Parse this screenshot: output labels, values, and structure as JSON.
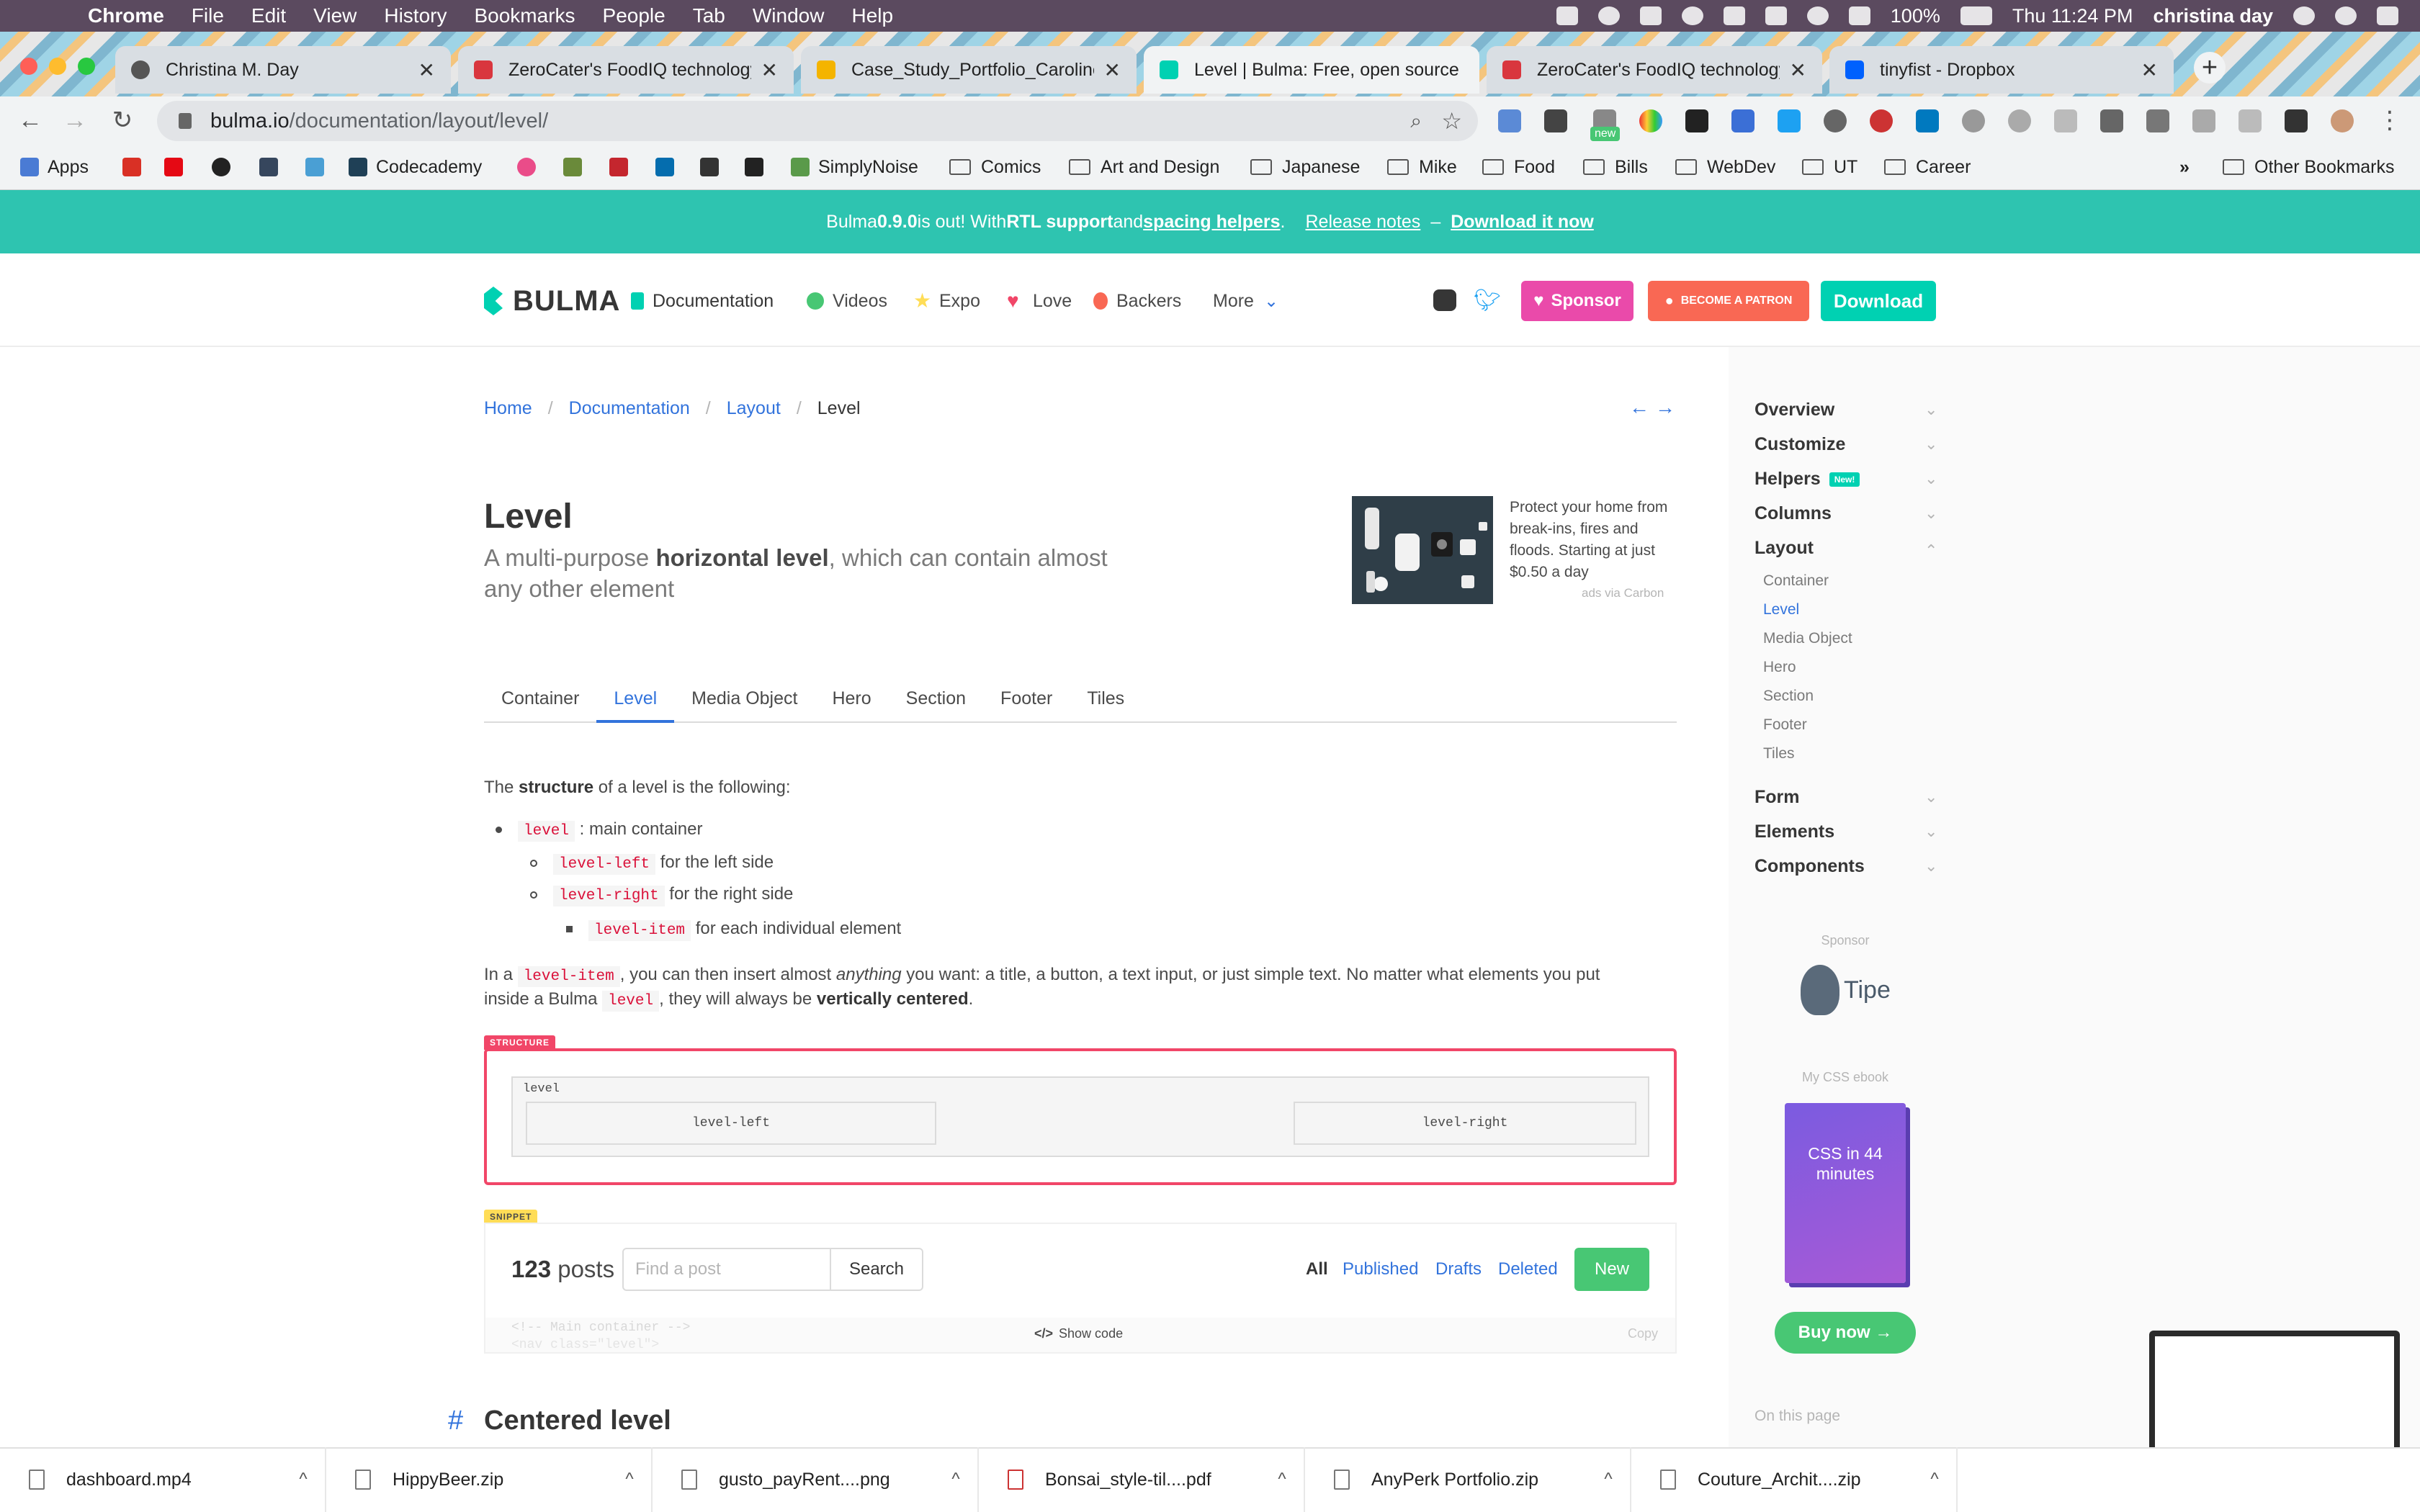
{
  "menubar": {
    "app": "Chrome",
    "items": [
      "File",
      "Edit",
      "View",
      "History",
      "Bookmarks",
      "People",
      "Tab",
      "Window",
      "Help"
    ],
    "battery": "100%",
    "clock": "Thu 11:24 PM",
    "user": "christina day"
  },
  "tabs": [
    {
      "title": "Christina M. Day"
    },
    {
      "title": "ZeroCater's FoodIQ technology"
    },
    {
      "title": "Case_Study_Portfolio_Caroline"
    },
    {
      "title": "Level | Bulma: Free, open source"
    },
    {
      "title": "ZeroCater's FoodIQ technology"
    },
    {
      "title": "tinyfist - Dropbox"
    }
  ],
  "omnibox": {
    "host": "bulma.io",
    "path": "/documentation/layout/level/"
  },
  "extension_badge": "new",
  "bookmarks": {
    "items": [
      "Apps",
      "Codecademy",
      "SimplyNoise",
      "Comics",
      "Art and Design",
      "Japanese",
      "Mike",
      "Food",
      "Bills",
      "WebDev",
      "UT",
      "Career"
    ],
    "overflow": "»",
    "other": "Other Bookmarks"
  },
  "banner": {
    "p1": "Bulma ",
    "version": "0.9.0",
    "p2": " is out! With ",
    "rtl": "RTL support",
    "p3": " and ",
    "spacing": "spacing helpers",
    "p4": ".",
    "release": "Release notes",
    "dash": "–",
    "download": "Download it now"
  },
  "navbar": {
    "logo": "BULMA",
    "items": [
      "Documentation",
      "Videos",
      "Expo",
      "Love",
      "Backers",
      "More"
    ],
    "sponsor": "Sponsor",
    "patron": "BECOME A PATRON",
    "download": "Download"
  },
  "breadcrumb": [
    "Home",
    "Documentation",
    "Layout",
    "Level"
  ],
  "hero": {
    "title": "Level",
    "sub1": "A multi-purpose ",
    "sub_bold": "horizontal level",
    "sub2": ", which can contain almost any other element"
  },
  "ad": {
    "text": "Protect your home from break-ins, fires and floods. Starting at just $0.50 a day",
    "via": "ads via Carbon"
  },
  "doc_tabs": [
    "Container",
    "Level",
    "Media Object",
    "Hero",
    "Section",
    "Footer",
    "Tiles"
  ],
  "content": {
    "intro1": "The ",
    "intro_bold": "structure",
    "intro2": " of a level is the following:",
    "li1_code": "level",
    "li1_text": " : main container",
    "li2_code": "level-left",
    "li2_text": " for the left side",
    "li3_code": "level-right",
    "li3_text": " for the right side",
    "li4_code": "level-item",
    "li4_text": " for each individual element",
    "p2a": "In a ",
    "p2_code": "level-item",
    "p2b": ", you can then insert almost ",
    "p2_em": "anything",
    "p2c": " you want: a title, a button, a text input, or just simple text. No matter what elements you put",
    "p3a": "inside a Bulma ",
    "p3_code": "level",
    "p3b": ", they will always be ",
    "p3_bold": "vertically centered",
    "p3c": "."
  },
  "structure": {
    "tag": "STRUCTURE",
    "level": "level",
    "left": "level-left",
    "right": "level-right"
  },
  "snippet": {
    "tag": "SNIPPET",
    "count": "123",
    "count_label": " posts",
    "placeholder": "Find a post",
    "search": "Search",
    "filters": [
      "All",
      "Published",
      "Drafts",
      "Deleted"
    ],
    "new": "New",
    "code_line1": "<!-- Main container -->",
    "code_line2": "<nav class=\"level\">",
    "show_code": "Show code",
    "copy": "Copy"
  },
  "section": {
    "hash": "#",
    "title": "Centered level"
  },
  "sidebar": {
    "headers": [
      "Overview",
      "Customize",
      "Helpers",
      "Columns",
      "Layout",
      "Form",
      "Elements",
      "Components"
    ],
    "new_tag": "New!",
    "layout_items": [
      "Container",
      "Level",
      "Media Object",
      "Hero",
      "Section",
      "Footer",
      "Tiles"
    ],
    "sponsor_label": "Sponsor",
    "sponsor_name": "Tipe",
    "ebook_label": "My CSS ebook",
    "book_title": "CSS in 44 minutes",
    "buy": "Buy now →",
    "on_page": "On this page"
  },
  "downloads": [
    "dashboard.mp4",
    "HippyBeer.zip",
    "gusto_payRent....png",
    "Bonsai_style-til....pdf",
    "AnyPerk Portfolio.zip",
    "Couture_Archit....zip"
  ],
  "colors": {
    "primary": "#00d1b2",
    "link": "#3273dc",
    "danger": "#f14668",
    "success": "#48c774"
  }
}
